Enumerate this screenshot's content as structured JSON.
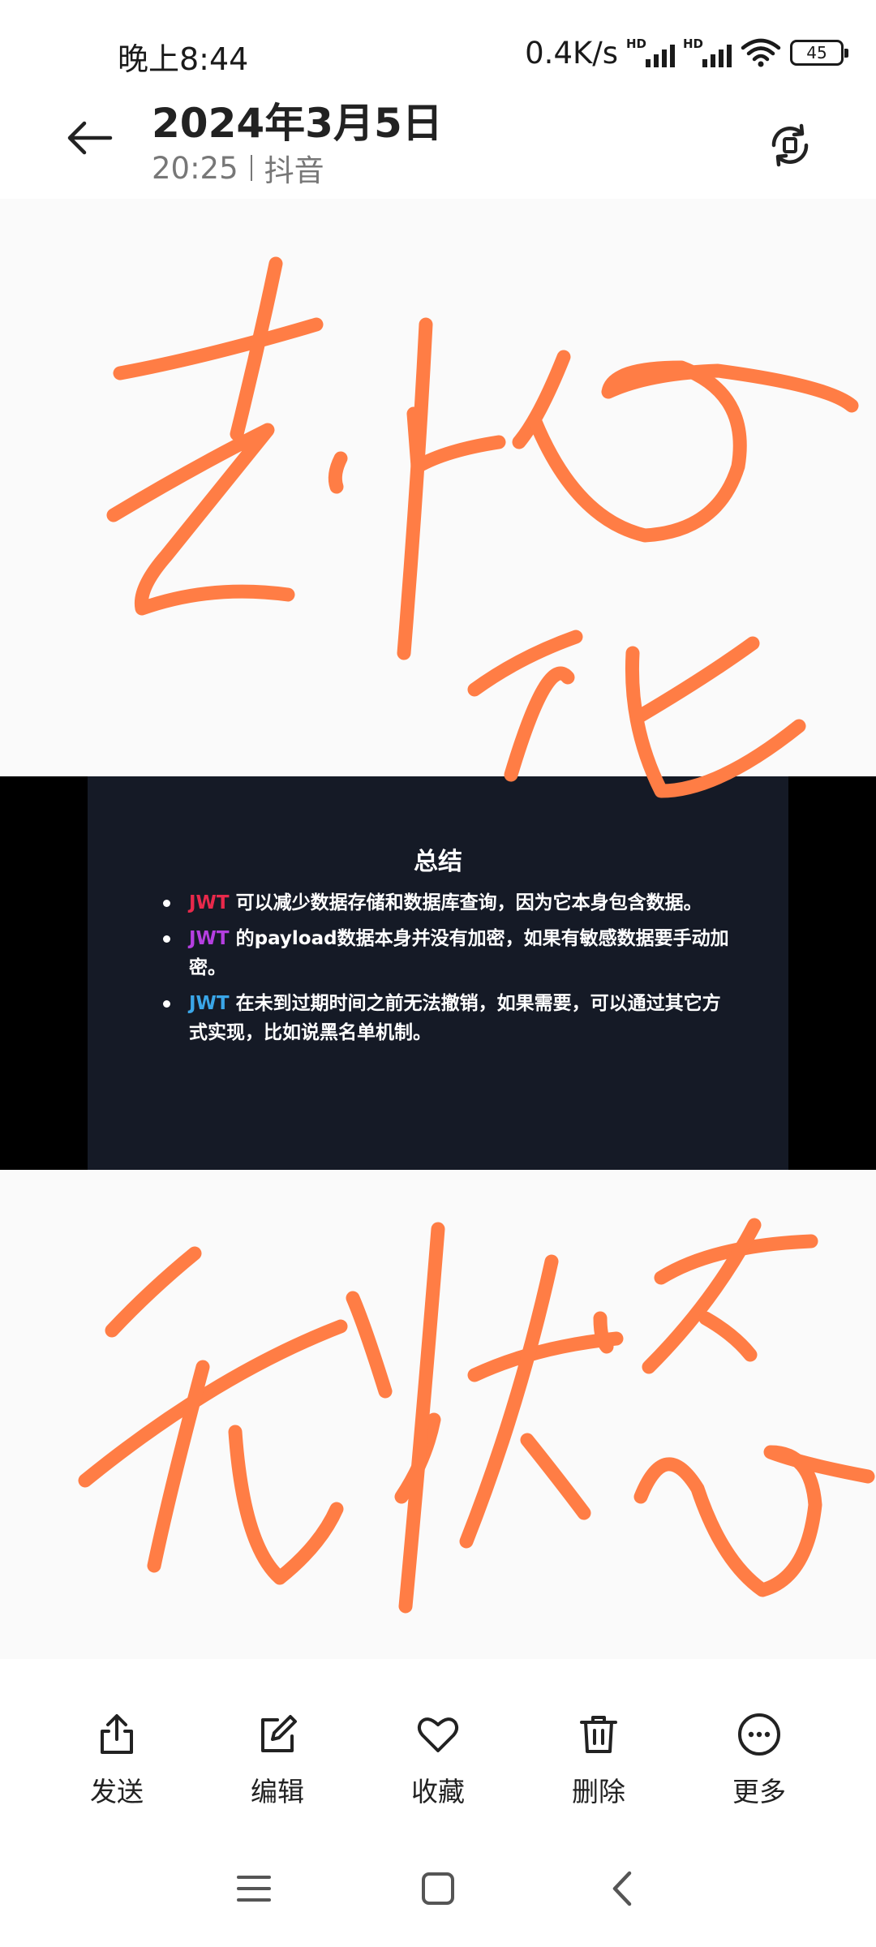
{
  "status_bar": {
    "time": "晚上8:44",
    "net_speed": "0.4K/s",
    "sim1_tag": "HD",
    "sim2_tag": "HD",
    "battery": "45"
  },
  "header": {
    "title": "2024年3月5日",
    "time": "20:25",
    "source": "抖音"
  },
  "slide": {
    "title": "总结",
    "bullets": [
      {
        "keyword": "JWT",
        "keyword_color": "#e8294b",
        "text": "可以减少数据存储和数据库查询，因为它本身包含数据。"
      },
      {
        "keyword": "JWT",
        "keyword_color": "#b53fe0",
        "text": "的payload数据本身并没有加密，如果有敏感数据要手动加密。"
      },
      {
        "keyword": "JWT",
        "keyword_color": "#3aa6e8",
        "text": "在未到过期时间之前无法撤销，如果需要，可以通过其它方式实现，比如说黑名单机制。"
      }
    ]
  },
  "ink_color": "#ff7d45",
  "toolbar": {
    "send": "发送",
    "edit": "编辑",
    "favorite": "收藏",
    "delete": "删除",
    "more": "更多"
  },
  "icons": {
    "back": "arrow-left-icon",
    "rotate": "rotate-icon",
    "send": "share-icon",
    "edit": "edit-icon",
    "favorite": "heart-icon",
    "delete": "trash-icon",
    "more": "more-icon",
    "nav_menu": "menu-icon",
    "nav_home": "home-icon",
    "nav_back": "back-icon"
  }
}
